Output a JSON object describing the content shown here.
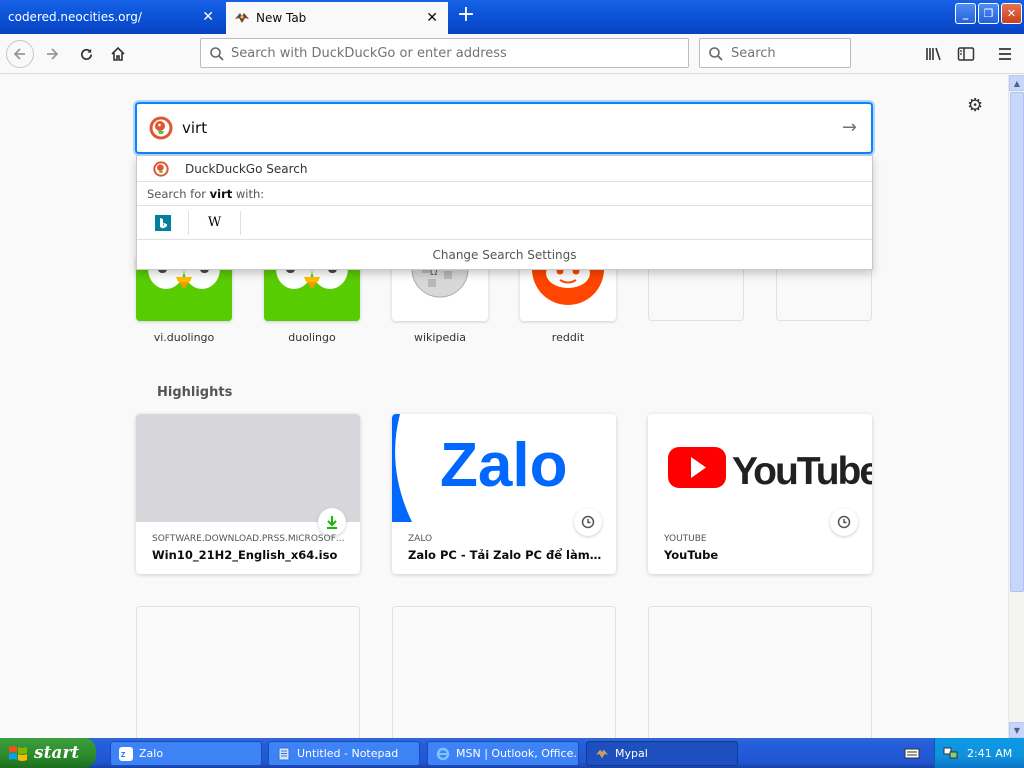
{
  "browser": {
    "tabs": [
      {
        "label": "codered.neocities.org/",
        "active": false
      },
      {
        "label": "New Tab",
        "active": true
      }
    ],
    "window_controls": {
      "minimize": "_",
      "restore": "❐",
      "close": "✕"
    },
    "url_placeholder": "Search with DuckDuckGo or enter address",
    "search_placeholder": "Search"
  },
  "search_popup": {
    "query": "virt",
    "engine_label": "DuckDuckGo Search",
    "search_for_prefix": "Search for ",
    "search_for_term": "virt",
    "search_for_suffix": " with:",
    "alt_engines": [
      "bing",
      "wikipedia"
    ],
    "wikipedia_glyph": "W",
    "settings_label": "Change Search Settings"
  },
  "top_sites": [
    {
      "label": "vi.duolingo",
      "icon": "duolingo-owl"
    },
    {
      "label": "duolingo",
      "icon": "duolingo-owl"
    },
    {
      "label": "wikipedia",
      "icon": "wikipedia-globe"
    },
    {
      "label": "reddit",
      "icon": "reddit-alien"
    },
    {
      "label": "",
      "icon": ""
    },
    {
      "label": "",
      "icon": ""
    }
  ],
  "highlights": {
    "title": "Highlights",
    "cards": [
      {
        "host": "SOFTWARE.DOWNLOAD.PRSS.MICROSOFT.COM",
        "title": "Win10_21H2_English_x64.iso",
        "badge": "download-icon"
      },
      {
        "host": "ZALO",
        "title": "Zalo PC - Tải Zalo PC để làm việc hiệu quả",
        "badge": "clock-icon",
        "thumb_text": "Zalo"
      },
      {
        "host": "YOUTUBE",
        "title": "YouTube",
        "badge": "clock-icon",
        "thumb_text": "YouTube"
      }
    ]
  },
  "taskbar": {
    "start_label": "start",
    "buttons": [
      {
        "label": "Zalo"
      },
      {
        "label": "Untitled - Notepad"
      },
      {
        "label": "MSN | Outlook, Office..."
      },
      {
        "label": "Mypal"
      }
    ],
    "clock": "2:41 AM"
  },
  "colors": {
    "accent": "#0a84ff",
    "xp_blue": "#245edb",
    "start_green": "#2b8a2b",
    "duolingo": "#58cc02",
    "reddit": "#ff4500",
    "zalo": "#0068ff",
    "youtube_red": "#ff0000"
  }
}
